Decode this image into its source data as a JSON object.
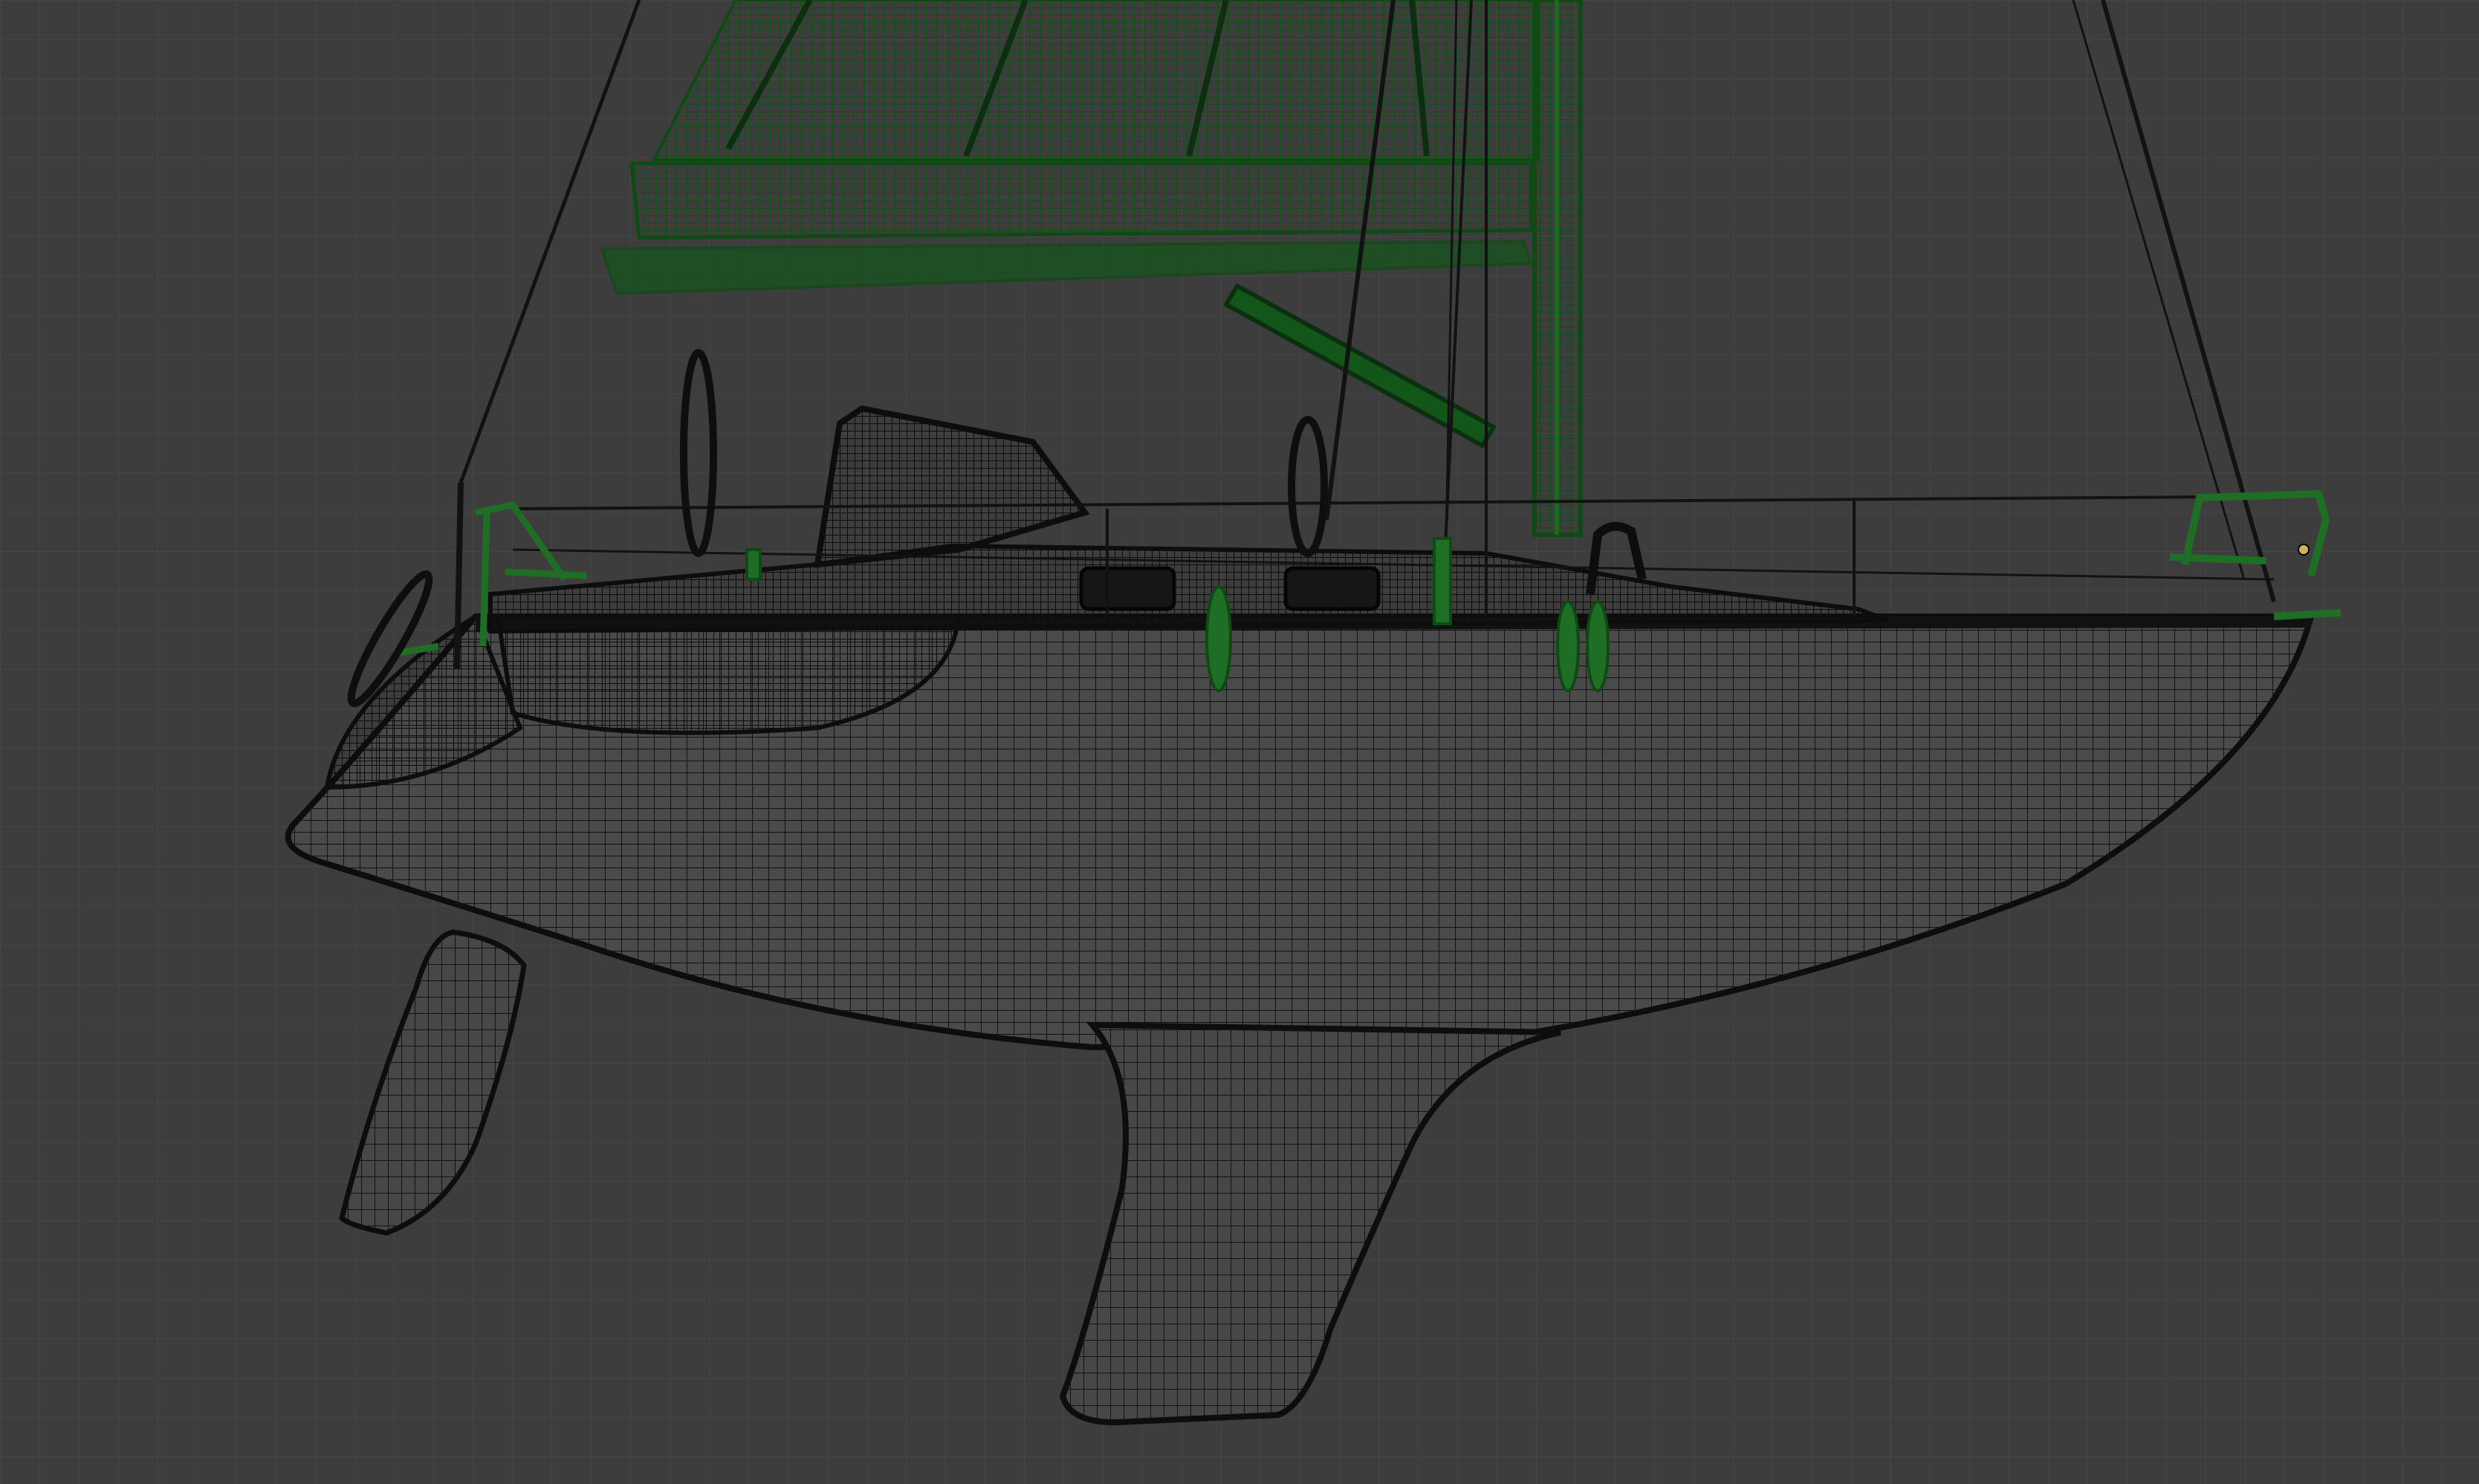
{
  "viewport": {
    "mode": "wireframe",
    "background_color": "#3d3d3d",
    "grid_color": "#464646"
  },
  "model": {
    "subject": "sailboat",
    "parts": {
      "hull": {
        "wire_color": "#0d0d0d",
        "fill_color": "#4a4a4a",
        "selected": false
      },
      "keel": {
        "wire_color": "#0d0d0d",
        "fill_color": "#474747",
        "selected": false
      },
      "rudder": {
        "wire_color": "#0d0d0d",
        "fill_color": "#474747",
        "selected": false
      },
      "cabin": {
        "wire_color": "#111111",
        "selected": false
      },
      "mast": {
        "wire_color": "#0f4a14",
        "selected": true
      },
      "boom_with_furled_mainsail": {
        "wire_color": "#13561a",
        "selected": true
      },
      "deck_hardware": {
        "wire_color": "#1e6b25",
        "selected": true
      },
      "rigging": {
        "wire_color": "#111111",
        "selected": false
      }
    },
    "selection_highlight_color": "#1f6e26",
    "active_vertex_color": "#d6b25a"
  }
}
